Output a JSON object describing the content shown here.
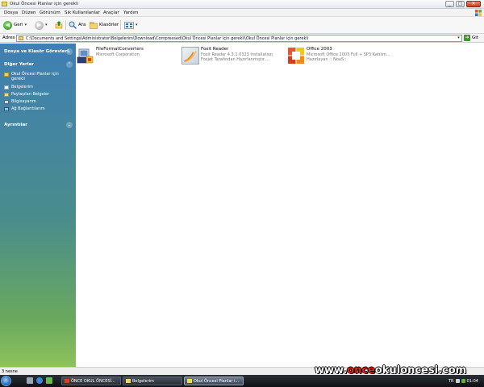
{
  "window": {
    "title": "Okul Öncesi Planlar için gerekli",
    "controls": {
      "minimize": "_",
      "maximize": "□",
      "close": "✕"
    }
  },
  "menubar": {
    "items": [
      "Dosya",
      "Düzen",
      "Görünüm",
      "Sık Kullanılanlar",
      "Araçlar",
      "Yardım"
    ]
  },
  "toolbar": {
    "back_label": "Geri",
    "search_label": "Ara",
    "folders_label": "Klasörler"
  },
  "address": {
    "label": "Adres",
    "path": "C:\\Documents and Settings\\Administrator\\Belgelerim\\Download\\Compressed\\Okul Öncesi Planlar için gerekli\\Okul Öncesi Planlar için gerekli",
    "go_label": "Git"
  },
  "sidebar": {
    "sections": [
      {
        "title": "Dosya ve Klasör Görevleri"
      },
      {
        "title": "Diğer Yerler"
      },
      {
        "title": "Ayrıntılar"
      }
    ],
    "places": [
      {
        "label": "Okul Öncesi Planlar için gerekli",
        "icon": "folder-icon"
      },
      {
        "label": "Belgelerim",
        "icon": "my-documents-icon"
      },
      {
        "label": "Paylaşılan Belgeler",
        "icon": "shared-documents-icon"
      },
      {
        "label": "Bilgisayarım",
        "icon": "my-computer-icon"
      },
      {
        "label": "Ağ Bağlantılarım",
        "icon": "network-places-icon"
      }
    ]
  },
  "files": [
    {
      "name": "FileFormatConverters",
      "line2": "Microsoft Corporation",
      "line3": "",
      "icon": "converter-installer-icon"
    },
    {
      "name": "Foxit Reader",
      "line2": "Foxit Reader 4.3.1.0323 Installation",
      "line3": "Foxjet Tarafından Hazırlanmıştır....",
      "icon": "foxit-reader-icon"
    },
    {
      "name": "Office 2003",
      "line2": "Microsoft Office 2003 Full + SP3 Katılım...",
      "line3": "Hazırlayan :: NouS::",
      "icon": "office-2003-icon"
    }
  ],
  "status": {
    "count": "3 nesne"
  },
  "taskbar": {
    "tasks": [
      {
        "label": "ÖNCE OKUL ÖNCESİ...",
        "active": false
      },
      {
        "label": "Belgelerim",
        "active": false
      },
      {
        "label": "Okul Öncesi Planlar i...",
        "active": true
      }
    ],
    "language": "TR",
    "clock": "01:04"
  },
  "watermark": {
    "part1": "www.",
    "part2": "once",
    "part3": "okuloncesi",
    "part4": ".com"
  },
  "colors": {
    "sidebar_top": "#3f7fb4",
    "sidebar_bottom": "#8ec25b",
    "watermark_accent": "#e4231c"
  }
}
